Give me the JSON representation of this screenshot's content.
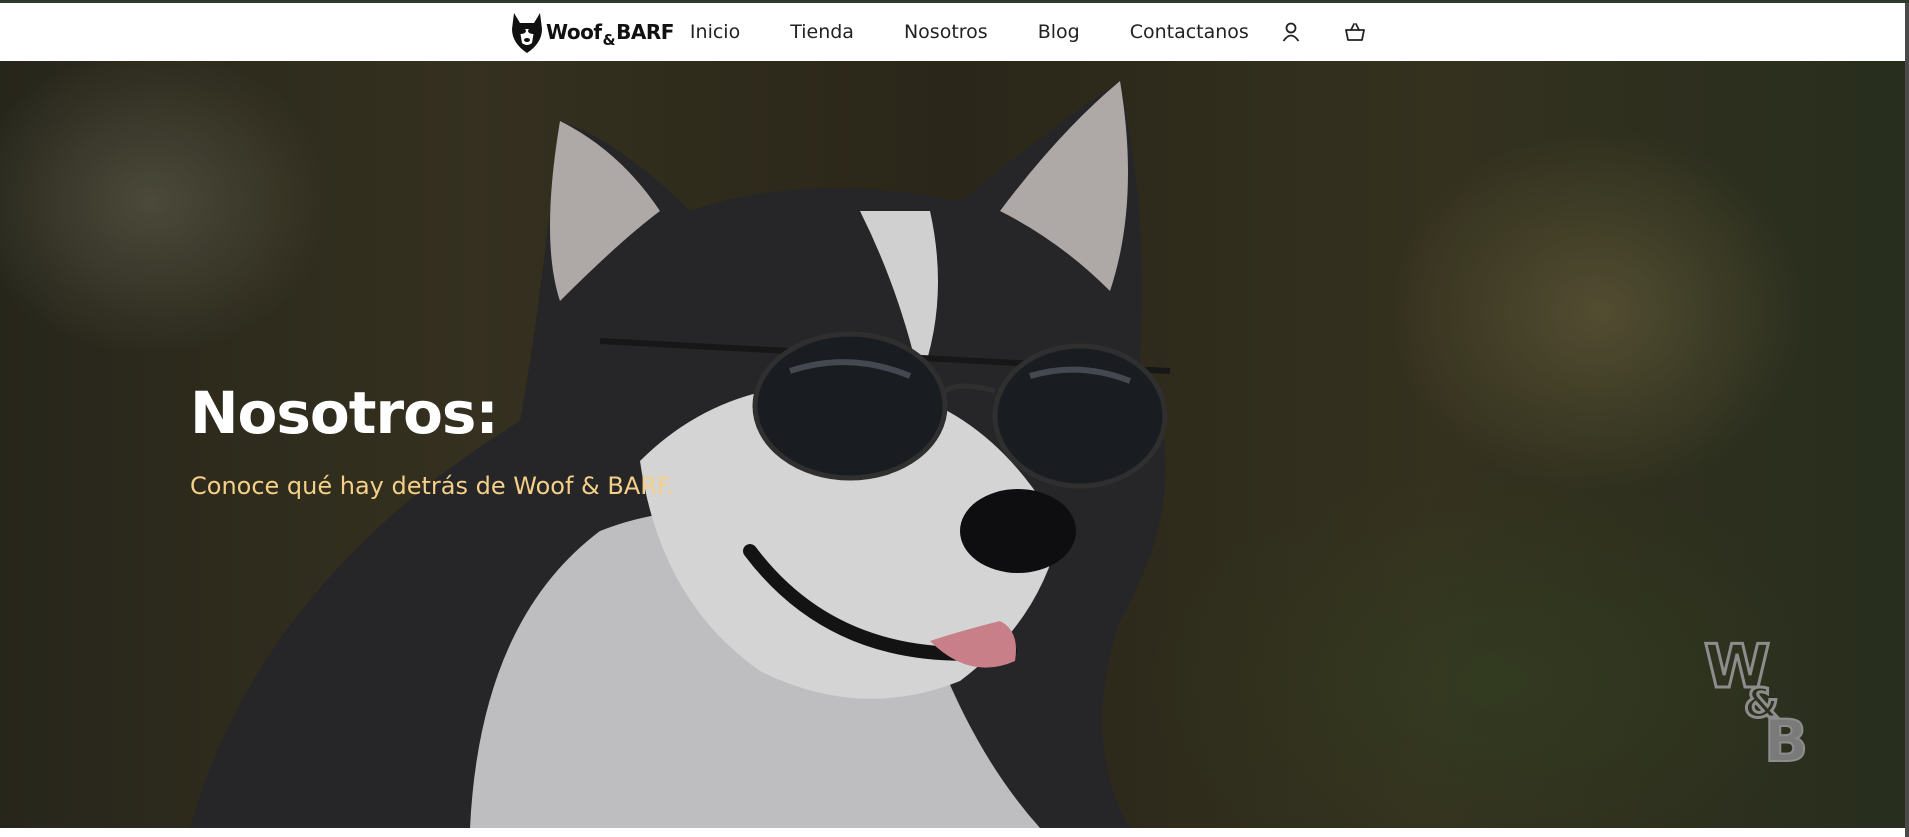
{
  "brand": {
    "logo_part1": "Woof",
    "logo_amp": "&",
    "logo_part2": "BARF",
    "watermark_text": "W&B"
  },
  "nav": {
    "items": [
      {
        "label": "Inicio"
      },
      {
        "label": "Tienda"
      },
      {
        "label": "Nosotros"
      },
      {
        "label": "Blog"
      },
      {
        "label": "Contactanos"
      }
    ],
    "icons": [
      "user-icon",
      "cart-icon"
    ]
  },
  "hero": {
    "title": "Nosotros:",
    "subtitle": "Conoce qué hay detrás de Woof & BARF."
  },
  "colors": {
    "subtitle": "#f4cf88",
    "title": "#ffffff",
    "nav_text": "#222222"
  }
}
